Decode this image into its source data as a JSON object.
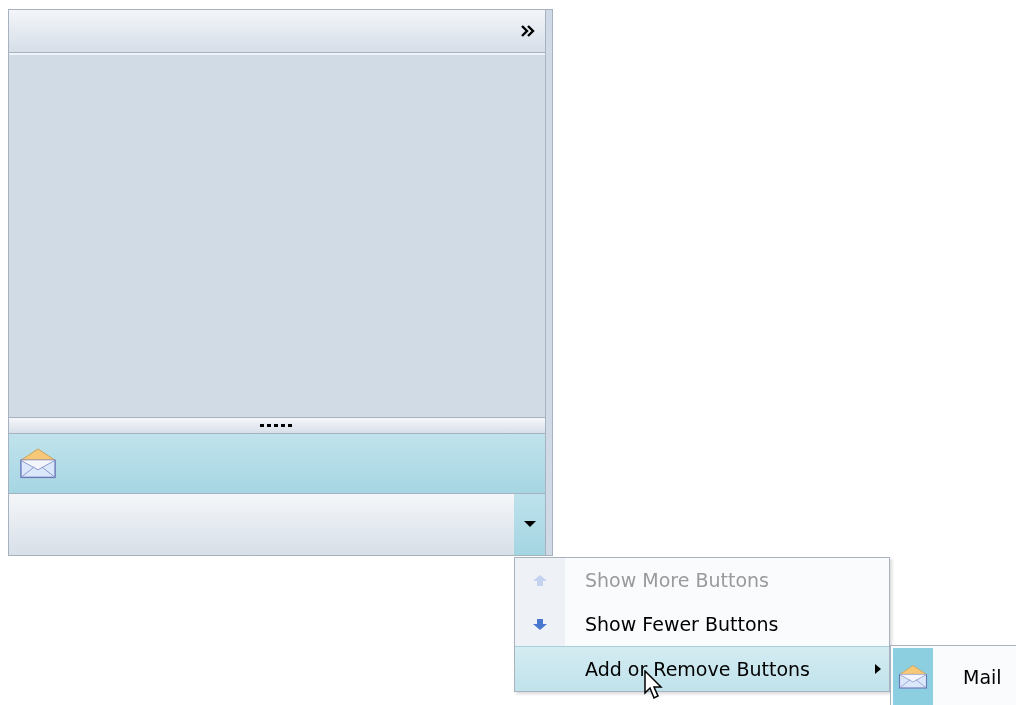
{
  "pane": {
    "buttons": [
      {
        "kind": "mail",
        "selected": true
      }
    ],
    "overflow_open": true
  },
  "menu": {
    "items": [
      {
        "label": "Show More Buttons",
        "kind": "up",
        "disabled": true,
        "selected": false,
        "submenu": false
      },
      {
        "label": "Show Fewer Buttons",
        "kind": "down",
        "disabled": false,
        "selected": false,
        "submenu": false
      },
      {
        "label": "Add or Remove Buttons",
        "kind": "plain",
        "disabled": false,
        "selected": true,
        "submenu": true
      }
    ]
  },
  "submenu": {
    "items": [
      {
        "label": "Mail",
        "kind": "mail",
        "checked": true
      }
    ]
  }
}
